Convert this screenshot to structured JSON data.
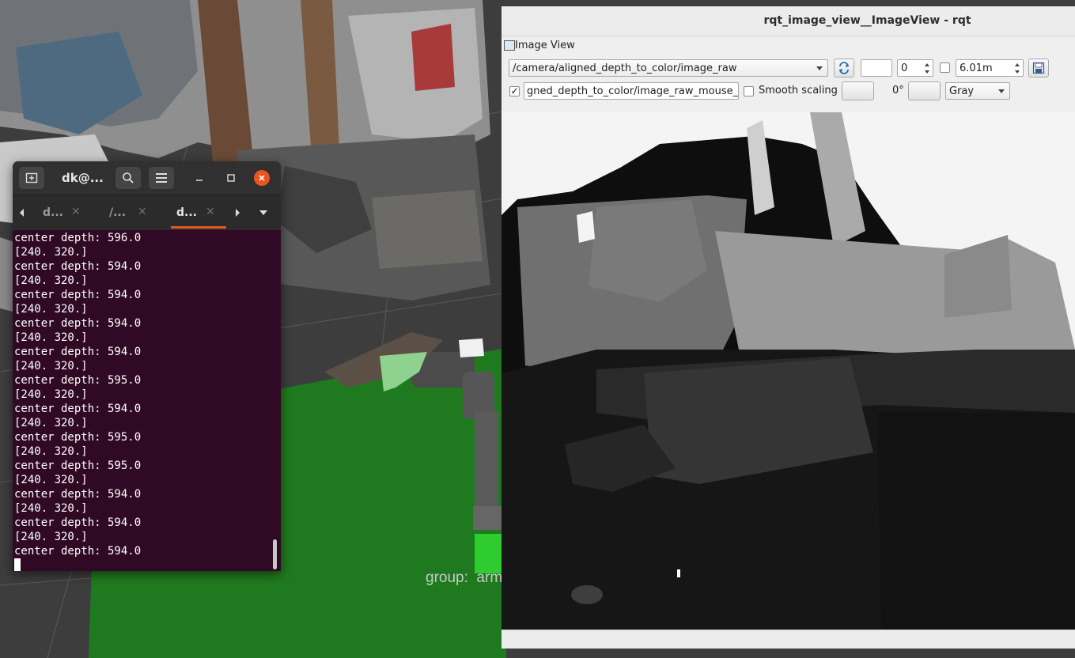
{
  "terminal": {
    "title": "dk@...",
    "tabs": [
      {
        "label": "d..."
      },
      {
        "label": "/..."
      },
      {
        "label": "d..."
      }
    ],
    "lines": [
      "center depth: 596.0",
      "[240. 320.]",
      "center depth: 594.0",
      "[240. 320.]",
      "center depth: 594.0",
      "[240. 320.]",
      "center depth: 594.0",
      "[240. 320.]",
      "center depth: 594.0",
      "[240. 320.]",
      "center depth: 595.0",
      "[240. 320.]",
      "center depth: 594.0",
      "[240. 320.]",
      "center depth: 595.0",
      "[240. 320.]",
      "center depth: 595.0",
      "[240. 320.]",
      "center depth: 594.0",
      "[240. 320.]",
      "center depth: 594.0",
      "[240. 320.]",
      "center depth: 594.0"
    ],
    "colors": {
      "background": "#300a24",
      "accent": "#e95420",
      "text": "#ffffff"
    }
  },
  "rviz": {
    "group_label": "group:  arm"
  },
  "rqt": {
    "window_title": "rqt_image_view__ImageView - rqt",
    "dock_title": "Image View",
    "topic_value": "/camera/aligned_depth_to_color/image_raw",
    "spin_value": "0",
    "max_range_value": "6.01m",
    "mouse_topic_value": "gned_depth_to_color/image_raw_mouse_left",
    "smooth_scaling_label": "Smooth scaling",
    "rotation_label": "0°",
    "colormap_value": "Gray",
    "icons": {
      "refresh": "refresh-icon",
      "save": "save-icon",
      "dock": "image-view-icon"
    }
  }
}
